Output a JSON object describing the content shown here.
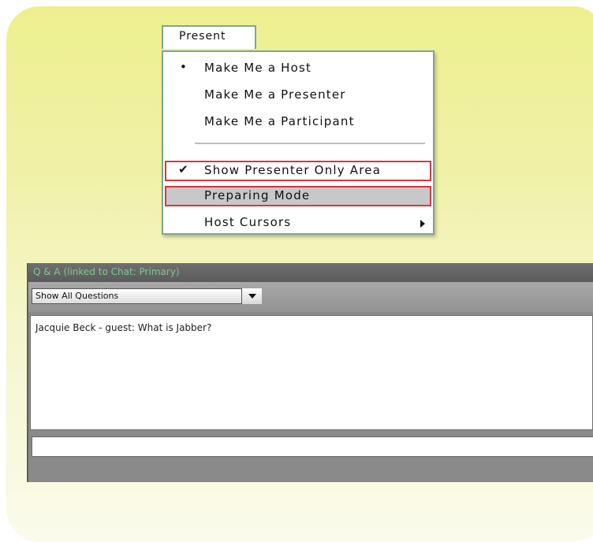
{
  "menu": {
    "tab_label": "Present",
    "items": [
      {
        "label": "Make Me a Host",
        "mark": "•"
      },
      {
        "label": "Make Me a Presenter",
        "mark": ""
      },
      {
        "label": "Make Me a Participant",
        "mark": ""
      },
      {
        "label": "Show Presenter Only Area",
        "mark": "✔"
      },
      {
        "label": "Preparing Mode",
        "mark": ""
      },
      {
        "label": "Host Cursors",
        "mark": ""
      }
    ]
  },
  "qa": {
    "title": "Q & A (linked to Chat: Primary)",
    "filter_value": "Show All Questions",
    "messages": [
      "Jacquie Beck - guest: What is Jabber?"
    ],
    "input_value": ""
  },
  "colors": {
    "highlight_border": "#d9363e",
    "menu_border": "#7fa68d",
    "qa_title_text": "#7dc98a"
  }
}
